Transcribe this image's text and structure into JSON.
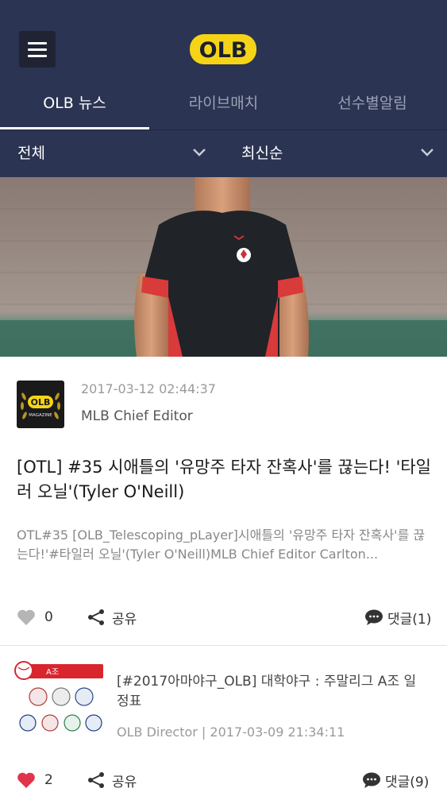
{
  "header": {
    "logo_text": "OLB",
    "menu_icon": "hamburger-menu-icon"
  },
  "tabs": [
    {
      "label": "OLB 뉴스",
      "active": true
    },
    {
      "label": "라이브매치",
      "active": false
    },
    {
      "label": "선수별알림",
      "active": false
    }
  ],
  "filters": {
    "category": "전체",
    "sort": "최신순"
  },
  "article1": {
    "avatar_text": "OLB",
    "avatar_sub": "MAGAZINE",
    "date": "2017-03-12 02:44:37",
    "author": "MLB Chief Editor",
    "title": "[OTL] #35 시애틀의 '유망주 타자 잔혹사'를 끊는다! '타일러 오닐'(Tyler O'Neill)",
    "excerpt": "OTL#35 [OLB_Telescoping_pLayer]시애틀의 '유망주 타자 잔혹사'를 끊는다!'#타일러 오닐'(Tyler O'Neill)MLB Chief Editor Carlton...",
    "likes": "0",
    "share_label": "공유",
    "comments_label": "댓글(1)",
    "liked": false
  },
  "article2": {
    "thumb_badge": "A조",
    "title": "[#2017아마야구_OLB] 대학야구 : 주말리그 A조 일정표",
    "meta": "OLB Director | 2017-03-09 21:34:11",
    "likes": "2",
    "share_label": "공유",
    "comments_label": "댓글(9)",
    "liked": true
  },
  "colors": {
    "header_bg": "#2b3452",
    "logo_yellow": "#f5d417",
    "like_active": "#e0344a",
    "like_inactive": "#b5b5b5"
  }
}
